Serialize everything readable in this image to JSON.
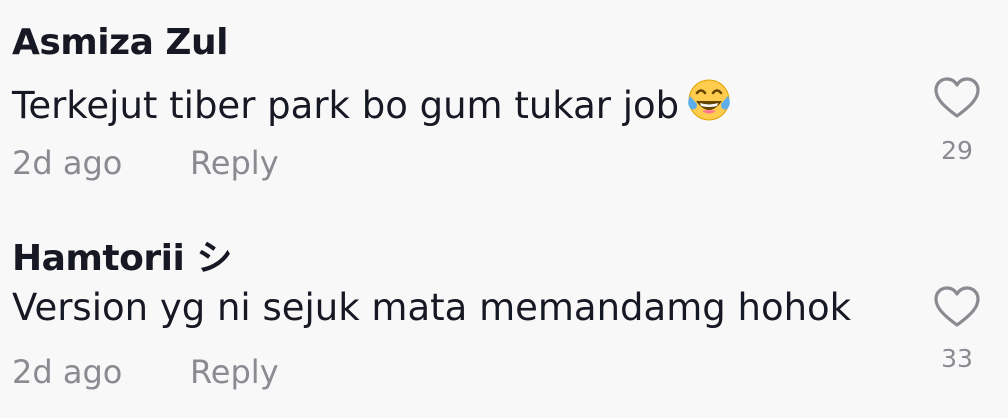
{
  "comments": [
    {
      "username": "Asmiza Zul",
      "text": "Terkejut tiber park bo gum tukar job",
      "emoji": "face-with-tears-of-joy",
      "time": "2d ago",
      "reply_label": "Reply",
      "likes": "29"
    },
    {
      "username": "Hamtorii シ",
      "text": "Version yg ni sejuk mata memandamg hohok",
      "time": "2d ago",
      "reply_label": "Reply",
      "likes": "33"
    }
  ],
  "colors": {
    "background": "#f8f8f8",
    "primary_text": "#161823",
    "secondary_text": "#8a8b91"
  }
}
